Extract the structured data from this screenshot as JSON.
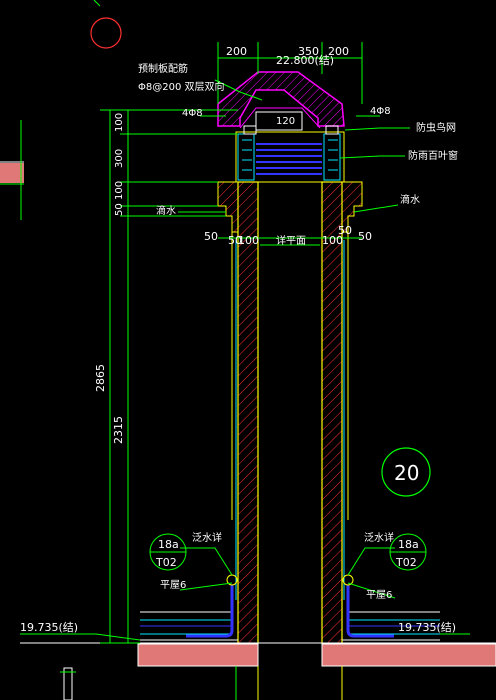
{
  "drawing": {
    "colors": {
      "background": "#000000",
      "wall": "#ffff00",
      "hatch": "#ff3030",
      "dim": "#00ff00",
      "text": "#ffffff",
      "slab": "#ff00ff",
      "ground": "#e07878",
      "louver": "#00ffff",
      "cyan": "#00e5ff",
      "blue": "#3333ff"
    },
    "top_dims": {
      "left": "200",
      "mid": "350",
      "right": "200"
    },
    "elevation_top": "22.800(结)",
    "slab_note_line1": "预制板配筋",
    "slab_note_line2": "Φ8@200 双层双向",
    "slab_label": "120",
    "bar_left": "4Φ8",
    "bar_right": "4Φ8",
    "mesh_note": "防虫鸟网",
    "louver_note": "防雨百叶窗",
    "drip_left": "滴水",
    "drip_right": "滴水",
    "dim_50_left": "50",
    "dim_50_inner_left": "50",
    "dim_100_left": "100",
    "plan_label": "详平面",
    "dim_100_right": "100",
    "dim_50_inner_right": "50",
    "dim_50_right": "50",
    "vert_dims": [
      "100",
      "300",
      "100",
      "50"
    ],
    "dim_2865": "2865",
    "dim_2315": "2315",
    "detail_number": "20",
    "flashing_left_label": "泛水详",
    "flashing_right_label": "泛水详",
    "bubble_left_top": "18a",
    "bubble_left_bottom": "T02",
    "bubble_right_top": "18a",
    "bubble_right_bottom": "T02",
    "roof_left": "平屋6",
    "roof_right": "平屋6",
    "elev_left": "19.735(结)",
    "elev_right": "19.735(结)"
  }
}
